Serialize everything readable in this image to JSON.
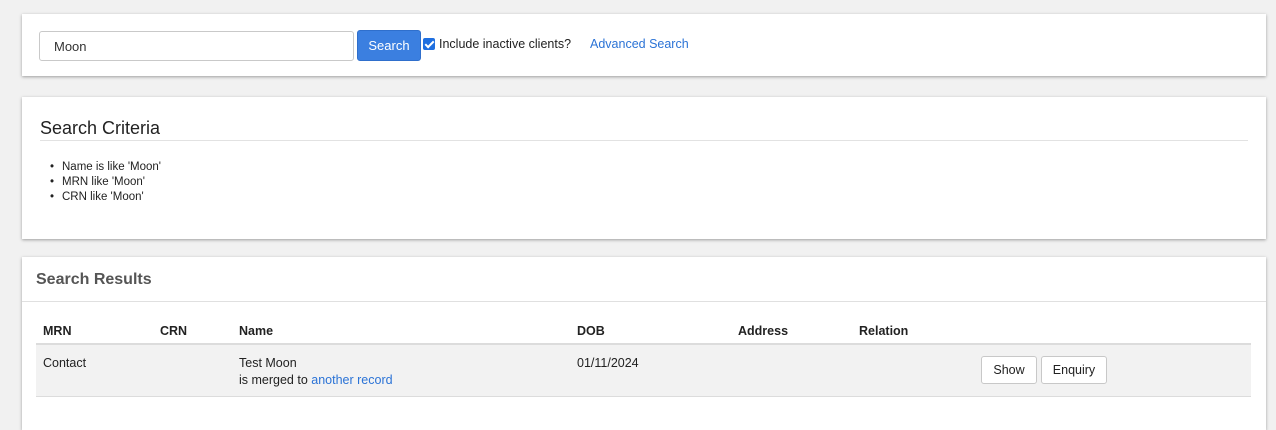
{
  "search": {
    "value": "Moon",
    "button_label": "Search",
    "include_inactive_checked": true,
    "include_inactive_label": "Include inactive clients?",
    "advanced_link": "Advanced Search"
  },
  "criteria": {
    "title": "Search Criteria",
    "items": [
      "Name is like 'Moon'",
      "MRN like 'Moon'",
      "CRN like 'Moon'"
    ]
  },
  "results": {
    "title": "Search Results",
    "columns": [
      "MRN",
      "CRN",
      "Name",
      "DOB",
      "Address",
      "Relation"
    ],
    "rows": [
      {
        "mrn": "Contact",
        "crn": "",
        "name": "Test Moon",
        "merged_prefix": "is merged to",
        "merged_link": "another record",
        "dob": "01/11/2024",
        "address": "",
        "relation": "",
        "show_label": "Show",
        "enquiry_label": "Enquiry"
      }
    ]
  },
  "colors": {
    "primary": "#3b7fe0",
    "link": "#2b73d6",
    "background": "#f1f1f1"
  }
}
